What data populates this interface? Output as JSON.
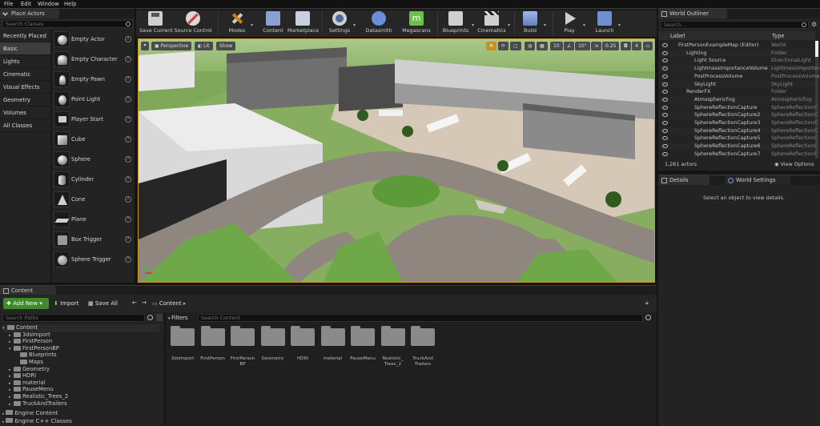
{
  "menu": [
    "File",
    "Edit",
    "Window",
    "Help"
  ],
  "place_actors": {
    "tab": "Place Actors",
    "search_placeholder": "Search Classes",
    "categories": [
      {
        "label": "Recently Placed"
      },
      {
        "label": "Basic"
      },
      {
        "label": "Lights"
      },
      {
        "label": "Cinematic"
      },
      {
        "label": "Visual Effects"
      },
      {
        "label": "Geometry"
      },
      {
        "label": "Volumes"
      },
      {
        "label": "All Classes"
      }
    ],
    "selected_category": "Basic",
    "actors": [
      "Empty Actor",
      "Empty Character",
      "Empty Pawn",
      "Point Light",
      "Player Start",
      "Cube",
      "Sphere",
      "Cylinder",
      "Cone",
      "Plane",
      "Box Trigger",
      "Sphere Trigger"
    ]
  },
  "toolbar": {
    "buttons": [
      {
        "label": "Save Current"
      },
      {
        "label": "Source Control"
      },
      {
        "label": "Modes"
      },
      {
        "label": "Content"
      },
      {
        "label": "Marketplace"
      },
      {
        "label": "Settings"
      },
      {
        "label": "Datasmith"
      },
      {
        "label": "Megascans"
      },
      {
        "label": "Blueprints"
      },
      {
        "label": "Cinematics"
      },
      {
        "label": "Build"
      },
      {
        "label": "Play"
      },
      {
        "label": "Launch"
      }
    ]
  },
  "viewport": {
    "perspective": "Perspective",
    "lit": "Lit",
    "show": "Show",
    "snap_grid": "10",
    "snap_angle": "10°",
    "scale": "0.25",
    "camera_speed": "4"
  },
  "outliner": {
    "tab": "World Outliner",
    "search_placeholder": "Search...",
    "col_label": "Label",
    "col_type": "Type",
    "rows": [
      {
        "name": "FirstPersonExampleMap (Editor)",
        "type": "World"
      },
      {
        "name": "Lighting",
        "type": "Folder"
      },
      {
        "name": "Light Source",
        "type": "DirectionalLight"
      },
      {
        "name": "LightmassImportanceVolume",
        "type": "LightmassImportance"
      },
      {
        "name": "PostProcessVolume",
        "type": "PostProcessVolume"
      },
      {
        "name": "SkyLight",
        "type": "SkyLight"
      },
      {
        "name": "RenderFX",
        "type": "Folder"
      },
      {
        "name": "AtmosphericFog",
        "type": "AtmosphericFog"
      },
      {
        "name": "SphereReflectionCapture",
        "type": "SphereReflectionC"
      },
      {
        "name": "SphereReflectionCapture2",
        "type": "SphereReflectionC"
      },
      {
        "name": "SphereReflectionCapture3",
        "type": "SphereReflectionC"
      },
      {
        "name": "SphereReflectionCapture4",
        "type": "SphereReflectionC"
      },
      {
        "name": "SphereReflectionCapture5",
        "type": "SphereReflectionC"
      },
      {
        "name": "SphereReflectionCapture6",
        "type": "SphereReflectionC"
      },
      {
        "name": "SphereReflectionCapture7",
        "type": "SphereReflectionC"
      }
    ],
    "actor_count": "1,261 actors",
    "view_options": "View Options"
  },
  "details": {
    "tab_details": "Details",
    "tab_world": "World Settings",
    "empty_msg": "Select an object to view details."
  },
  "content_browser": {
    "tab": "Content Browser",
    "add_new": "Add New",
    "import": "Import",
    "save_all": "Save All",
    "path_root": "Content",
    "search_paths": "Search Paths",
    "filters": "Filters",
    "search_content": "Search Content",
    "tree": [
      {
        "label": "Content",
        "level": 0,
        "open": true
      },
      {
        "label": "3dsImport",
        "level": 1
      },
      {
        "label": "FirstPerson",
        "level": 1
      },
      {
        "label": "FirstPersonBP",
        "level": 1,
        "open": true
      },
      {
        "label": "Blueprints",
        "level": 2
      },
      {
        "label": "Maps",
        "level": 2
      },
      {
        "label": "Geometry",
        "level": 1
      },
      {
        "label": "HDRI",
        "level": 1
      },
      {
        "label": "material",
        "level": 1
      },
      {
        "label": "PauseMenu",
        "level": 1
      },
      {
        "label": "Realistic_Trees_2",
        "level": 1
      },
      {
        "label": "TruckAndTrailers",
        "level": 1
      }
    ],
    "engine_content": "Engine Content",
    "engine_cpp": "Engine C++ Classes",
    "folders": [
      "3dsImport",
      "FirstPerson",
      "FirstPerson BP",
      "Geometry",
      "HDRI",
      "material",
      "PauseMenu",
      "Realistic_ Trees_2",
      "TruckAnd Trailers"
    ]
  }
}
